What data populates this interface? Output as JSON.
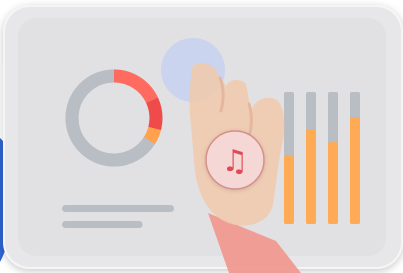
{
  "illustration": {
    "device": {
      "frame_color": "#e7e7e9",
      "screen_color": "#e1e1e3",
      "edge_color": "#f5f5f6"
    },
    "blue_accent": "#2f63d6",
    "donut": {
      "track_color": "#b9bdc4",
      "segments": [
        {
          "label": "coral",
          "fraction": 0.18,
          "color": "#ff6b5f"
        },
        {
          "label": "red",
          "fraction": 0.11,
          "color": "#f04b4b"
        },
        {
          "label": "orange",
          "fraction": 0.05,
          "color": "#ffa14d"
        },
        {
          "label": "gray",
          "fraction": 0.66,
          "color": "#b9bdc4"
        }
      ]
    },
    "text_lines": [
      {
        "fraction": 1.0,
        "color": "#b9bdc4"
      },
      {
        "fraction": 0.72,
        "color": "#b9bdc4"
      }
    ],
    "bars": {
      "track_color": "#b9bdc4",
      "fill_color": "#ffaa55",
      "levels": [
        0.52,
        0.72,
        0.62,
        0.81
      ]
    },
    "touch_indicator": {
      "color": "#c8d3ee",
      "opacity": 0.9
    },
    "hand": {
      "skin_color": "#f0c9ad",
      "sleeve_color": "#f09a90",
      "opacity": 0.88
    },
    "music_button": {
      "icon": "music-note-icon",
      "glyph": "♫",
      "fill_color": "#f5d8d6",
      "stroke_color": "#d68e8a",
      "icon_color": "#e04a55"
    }
  }
}
